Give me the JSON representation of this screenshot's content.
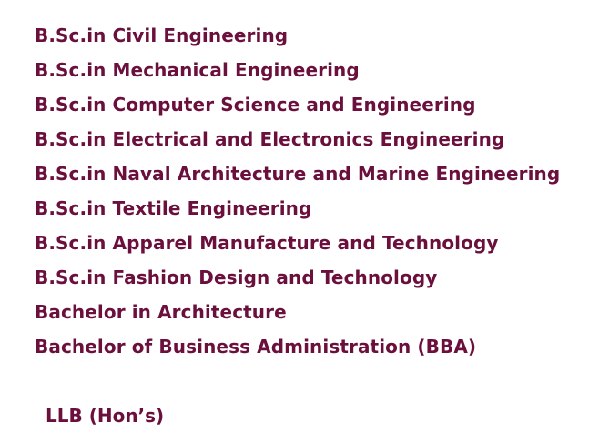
{
  "programs": [
    "B.Sc.in Civil Engineering",
    "B.Sc.in Mechanical Engineering",
    "B.Sc.in Computer Science and Engineering",
    "B.Sc.in Electrical and Electronics Engineering",
    "B.Sc.in Naval Architecture and Marine Engineering",
    "B.Sc.in Textile Engineering",
    "B.Sc.in Apparel Manufacture and Technology",
    "B.Sc.in Fashion Design and Technology",
    "Bachelor in Architecture",
    "Bachelor of Business Administration (BBA)"
  ],
  "llb": "LLB (Hon’s)",
  "colors": {
    "text": "#6b0f3c",
    "background": "#ffffff"
  }
}
